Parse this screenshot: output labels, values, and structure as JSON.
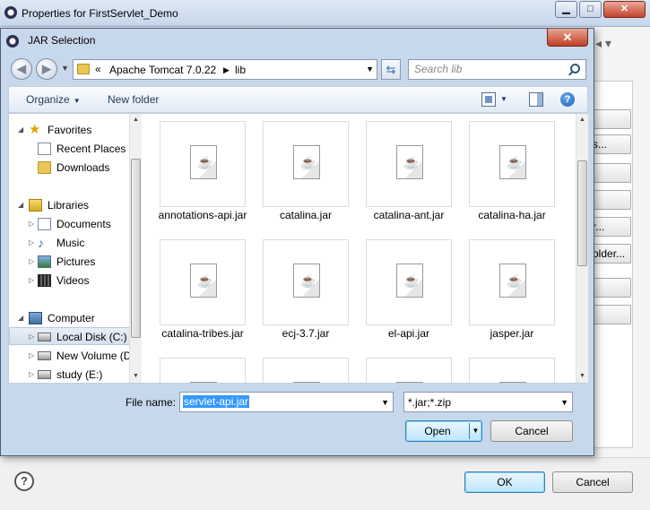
{
  "properties_window": {
    "title": "Properties for FirstServlet_Demo",
    "controls": {
      "minimize": "▁",
      "maximize": "□",
      "close": "✕"
    },
    "side_buttons": [
      "",
      "s...",
      "",
      "",
      "r...",
      "older...",
      "",
      ""
    ],
    "ok_label": "OK",
    "cancel_label": "Cancel",
    "help_label": "?"
  },
  "dialog": {
    "title": "JAR Selection",
    "close": "✕",
    "address": {
      "chevron": "«",
      "segments": [
        "Apache Tomcat 7.0.22",
        "lib"
      ]
    },
    "search_placeholder": "Search lib",
    "toolbar": {
      "organize": "Organize",
      "new_folder": "New folder"
    },
    "nav": {
      "favorites": "Favorites",
      "recent_places": "Recent Places",
      "downloads": "Downloads",
      "libraries": "Libraries",
      "documents": "Documents",
      "music": "Music",
      "pictures": "Pictures",
      "videos": "Videos",
      "computer": "Computer",
      "local_disk": "Local Disk (C:)",
      "new_volume": "New Volume (D",
      "study": "study (E:)"
    },
    "files": [
      "annotations-api.jar",
      "catalina.jar",
      "catalina-ant.jar",
      "catalina-ha.jar",
      "catalina-tribes.jar",
      "ecj-3.7.jar",
      "el-api.jar",
      "jasper.jar",
      "",
      "",
      "",
      ""
    ],
    "file_name_label": "File name:",
    "file_name_value": "servlet-api.jar",
    "filter_value": "*.jar;*.zip",
    "open_label": "Open",
    "cancel_label": "Cancel"
  }
}
